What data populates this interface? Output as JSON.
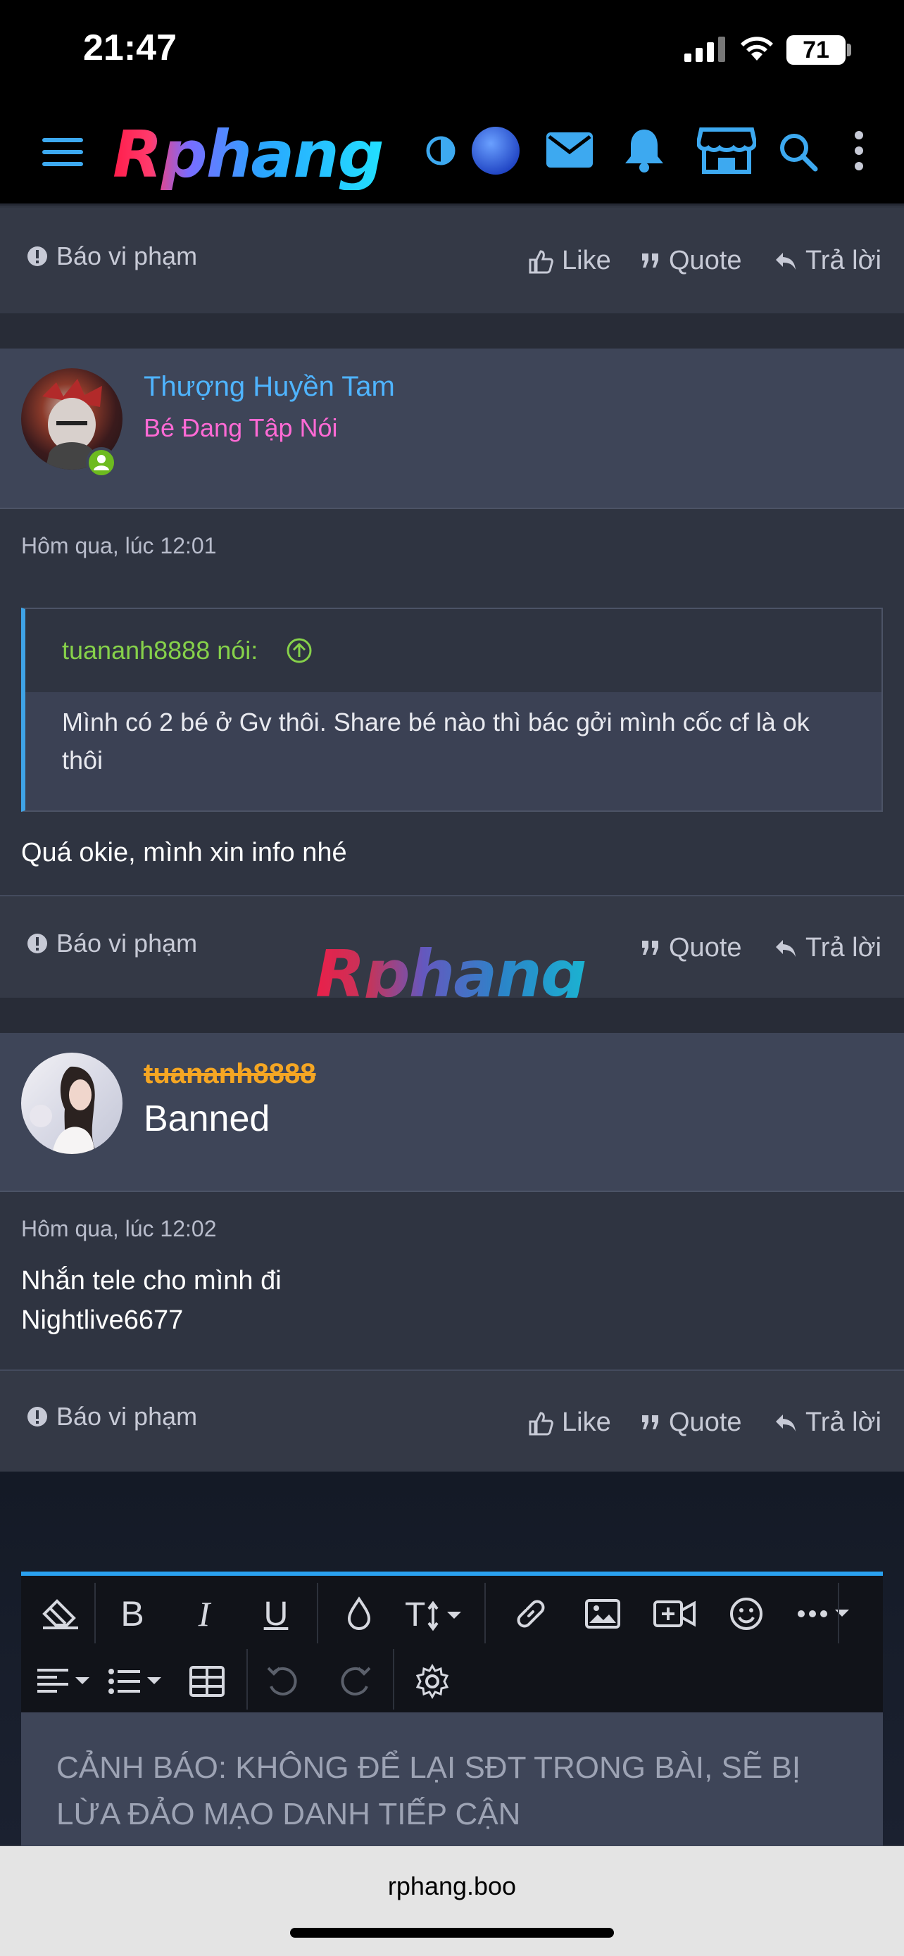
{
  "status_bar": {
    "time": "21:47",
    "battery": "71"
  },
  "header": {
    "logo_text": "Rphang"
  },
  "post_footer_top": {
    "report": "Báo vi phạm",
    "like": "Like",
    "quote": "Quote",
    "reply": "Trả lời"
  },
  "post1": {
    "username": "Thượng Huyền Tam",
    "user_title": "Bé Đang Tập Nói",
    "timestamp": "Hôm qua, lúc 12:01",
    "quote_author": "tuananh8888 nói:",
    "quote_text": "Mình có 2 bé ở Gv thôi. Share bé nào thì bác gởi mình cốc cf là ok thôi",
    "message": "Quá okie, mình xin info nhé",
    "footer": {
      "report": "Báo vi phạm",
      "quote": "Quote",
      "reply": "Trả lời"
    }
  },
  "watermark": "Rphang",
  "post2": {
    "username": "tuananh8888",
    "user_title": "Banned",
    "timestamp": "Hôm qua, lúc 12:02",
    "message_line1": "Nhắn tele cho mình đi",
    "message_line2": "Nightlive6677",
    "footer": {
      "report": "Báo vi phạm",
      "like": "Like",
      "quote": "Quote",
      "reply": "Trả lời"
    }
  },
  "editor": {
    "placeholder": "CẢNH BÁO: KHÔNG ĐỂ LẠI SĐT TRONG BÀI, SẼ BỊ LỪA ĐẢO MẠO DANH TIẾP CẬN",
    "toolbar_icons": [
      "eraser-icon",
      "bold-icon",
      "italic-icon",
      "underline-icon",
      "color-drop-icon",
      "text-size-icon",
      "link-icon",
      "image-icon",
      "video-icon",
      "emoji-icon",
      "more-icon",
      "align-icon",
      "list-icon",
      "table-icon",
      "undo-icon",
      "redo-icon",
      "settings-icon"
    ]
  },
  "browser": {
    "url": "rphang.boo"
  },
  "colors": {
    "accent": "#2aa1f0",
    "username": "#4fb4ff",
    "user_title": "#ff6ad5",
    "quote_author": "#86d14a",
    "banned_name": "#f5a623"
  }
}
